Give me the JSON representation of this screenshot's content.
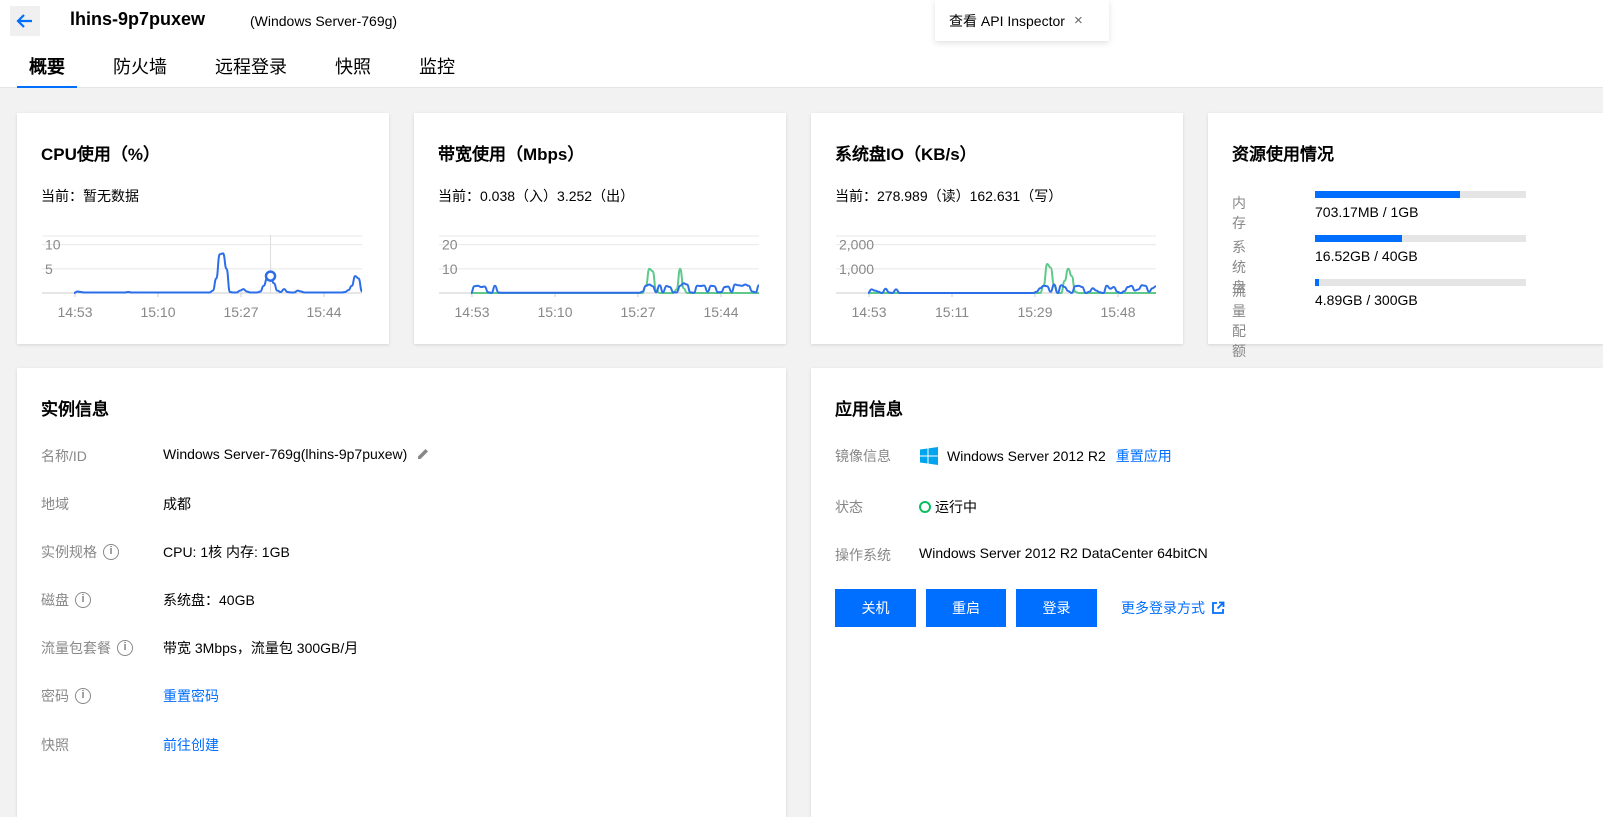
{
  "header": {
    "instance_name": "lhins-9p7puxew",
    "instance_subtitle": "(Windows Server-769g)",
    "api_inspector": "查看 API Inspector",
    "close_glyph": "×"
  },
  "tabs": [
    {
      "label": "概要",
      "active": true
    },
    {
      "label": "防火墙",
      "active": false
    },
    {
      "label": "远程登录",
      "active": false
    },
    {
      "label": "快照",
      "active": false
    },
    {
      "label": "监控",
      "active": false
    }
  ],
  "cpu_card": {
    "title": "CPU使用（%）",
    "current": "当前：暂无数据"
  },
  "bw_card": {
    "title": "带宽使用（Mbps）",
    "current": "当前：0.038（入）3.252（出）"
  },
  "disk_card": {
    "title": "系统盘IO（KB/s）",
    "current": "当前：278.989（读）162.631（写）"
  },
  "chart_data": [
    {
      "type": "line",
      "title": "CPU使用（%）",
      "x": [
        "14:53",
        "15:10",
        "15:27",
        "15:44"
      ],
      "yticks": [
        "10",
        "5"
      ],
      "ylim": [
        0,
        12
      ],
      "series": [
        {
          "color": "#2b6ee8",
          "values": [
            0,
            0.3,
            0.2,
            0.1,
            0.1,
            0.1,
            0.1,
            0.1,
            0.1,
            0.1,
            0.1,
            0.1,
            0.1,
            0.1,
            0.1,
            0.1,
            0.2,
            0.1,
            0.1,
            0.1,
            0.1,
            0.1,
            0.1,
            0.1,
            0.1,
            0.1,
            0.1,
            0.1,
            0.1,
            0.1,
            0.1,
            0.1,
            0.1,
            0.1,
            0.1,
            0.1,
            0.1,
            0.1,
            0.1,
            0.1,
            0.1,
            0.5,
            3,
            8,
            8.2,
            5,
            0.2,
            0.1,
            0.1,
            0.5,
            0.8,
            0.3,
            0.1,
            0.1,
            0.1,
            0.3,
            1.5,
            3,
            3.5,
            2,
            0.5,
            0.2,
            0.8,
            0.2,
            0.1,
            0.1,
            0.5,
            0.3,
            0.1,
            0.1,
            0.1,
            0.1,
            0.1,
            0.1,
            0.1,
            0.1,
            0.1,
            0.1,
            0.1,
            0.1,
            0.2,
            0.6,
            1.5,
            3.5,
            3,
            0.3
          ]
        }
      ],
      "marker_index": 58
    },
    {
      "type": "line",
      "title": "带宽使用（Mbps）",
      "x": [
        "14:53",
        "15:10",
        "15:27",
        "15:44"
      ],
      "yticks": [
        "20",
        "10"
      ],
      "ylim": [
        0,
        24
      ],
      "series": [
        {
          "color": "#2b6ee8",
          "values": [
            0,
            2.8,
            3,
            2.5,
            2.7,
            0.3,
            0.1,
            3,
            0.2,
            0.1,
            0.1,
            0.1,
            0.1,
            0.1,
            0.1,
            0.1,
            0.1,
            0.1,
            0.1,
            0.1,
            0.1,
            0.1,
            0.1,
            0.1,
            0.1,
            0.1,
            0.1,
            0.1,
            0.1,
            0.1,
            0.1,
            0.1,
            0.1,
            0.1,
            0.1,
            0.1,
            0.1,
            0.1,
            0.1,
            0.1,
            0.1,
            0.1,
            0.1,
            0.1,
            0.1,
            0.1,
            0.1,
            0.1,
            0.1,
            0.1,
            0.5,
            3,
            3.5,
            2.8,
            0.3,
            3.2,
            0.3,
            2.9,
            2.5,
            0.3,
            0.2,
            3,
            4,
            3.5,
            0.3,
            0.1,
            3,
            2.9,
            3.1,
            0.5,
            3,
            2.8,
            0.3,
            0.4,
            2.5,
            2.7,
            0.4,
            3.5,
            3.2,
            3,
            3.5,
            3,
            0.6,
            0.3,
            3.2
          ]
        },
        {
          "color": "#5ec98a",
          "values": [
            0,
            0,
            0,
            0,
            0,
            0,
            0,
            0,
            0,
            0,
            0,
            0,
            0,
            0,
            0,
            0,
            0,
            0,
            0,
            0,
            0,
            0,
            0,
            0,
            0,
            0,
            0,
            0,
            0,
            0,
            0,
            0,
            0,
            0,
            0,
            0,
            0,
            0,
            0,
            0,
            0,
            0,
            0,
            0,
            0,
            0,
            0,
            0,
            0,
            0,
            0,
            3,
            10,
            9,
            1,
            0,
            0,
            0,
            0,
            0,
            1.5,
            10,
            2,
            0,
            0,
            0,
            0,
            0,
            0,
            0,
            0,
            0,
            0,
            0,
            0,
            0,
            0,
            0,
            0,
            0,
            0,
            0,
            0,
            0,
            0
          ]
        }
      ]
    },
    {
      "type": "line",
      "title": "系统盘IO（KB/s）",
      "x": [
        "14:53",
        "15:11",
        "15:29",
        "15:48"
      ],
      "yticks": [
        "2,000",
        "1,000"
      ],
      "ylim": [
        0,
        2400
      ],
      "series": [
        {
          "color": "#2b6ee8",
          "values": [
            0,
            150,
            100,
            50,
            0,
            180,
            20,
            0,
            150,
            0,
            0,
            0,
            0,
            0,
            0,
            0,
            0,
            0,
            0,
            0,
            0,
            0,
            0,
            0,
            0,
            0,
            0,
            0,
            0,
            0,
            0,
            0,
            0,
            0,
            0,
            0,
            0,
            0,
            0,
            0,
            0,
            0,
            0,
            0,
            0,
            0,
            0,
            0,
            50,
            200,
            300,
            280,
            50,
            350,
            0,
            320,
            250,
            80,
            0,
            280,
            300,
            250,
            0,
            50,
            200,
            100,
            30,
            0,
            300,
            180,
            250,
            50,
            0,
            80,
            250,
            300,
            100,
            150,
            320,
            300,
            50,
            200,
            280
          ]
        },
        {
          "color": "#5ec98a",
          "values": [
            0,
            0,
            0,
            0,
            0,
            0,
            0,
            0,
            0,
            0,
            0,
            0,
            0,
            0,
            0,
            0,
            0,
            0,
            0,
            0,
            0,
            0,
            0,
            0,
            0,
            0,
            0,
            0,
            0,
            0,
            0,
            0,
            0,
            0,
            0,
            0,
            0,
            0,
            0,
            0,
            0,
            0,
            0,
            0,
            0,
            0,
            0,
            0,
            0,
            0,
            300,
            1200,
            1050,
            300,
            0,
            0,
            500,
            1000,
            700,
            50,
            0,
            0,
            0,
            0,
            0,
            0,
            0,
            0,
            0,
            0,
            0,
            0,
            0,
            0,
            0,
            0,
            0,
            0,
            0,
            0,
            0,
            0,
            0
          ]
        }
      ]
    }
  ],
  "resource_card": {
    "title": "资源使用情况",
    "items": [
      {
        "label": "内存",
        "value": "703.17MB / 1GB",
        "fraction": 0.687
      },
      {
        "label": "系统盘",
        "value": "16.52GB / 40GB",
        "fraction": 0.413
      },
      {
        "label": "流量配额",
        "value": "4.89GB / 300GB",
        "fraction": 0.016
      }
    ]
  },
  "instance_info": {
    "title": "实例信息",
    "name_label": "名称/ID",
    "name_value": "Windows Server-769g(lhins-9p7puxew)",
    "region_label": "地域",
    "region_value": "成都",
    "spec_label": "实例规格",
    "spec_value": "CPU: 1核 内存: 1GB",
    "disk_label": "磁盘",
    "disk_value": "系统盘：40GB",
    "traffic_label": "流量包套餐",
    "traffic_value": "带宽 3Mbps，流量包 300GB/月",
    "password_label": "密码",
    "password_link": "重置密码",
    "snapshot_label": "快照",
    "snapshot_link": "前往创建",
    "info_glyph": "i"
  },
  "app_info": {
    "title": "应用信息",
    "image_label": "镜像信息",
    "image_value": "Windows Server 2012 R2",
    "reset_app": "重置应用",
    "status_label": "状态",
    "status_value": "运行中",
    "os_label": "操作系统",
    "os_value": "Windows Server 2012 R2 DataCenter 64bitCN",
    "btn_shutdown": "关机",
    "btn_restart": "重启",
    "btn_login": "登录",
    "more_login": "更多登录方式"
  },
  "colors": {
    "accent": "#006eff",
    "running": "#0abf5b",
    "series_blue": "#2b6ee8",
    "series_green": "#5ec98a"
  }
}
